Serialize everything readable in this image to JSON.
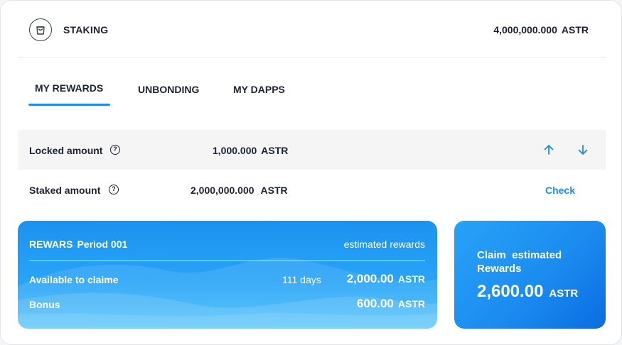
{
  "header": {
    "title": "STAKING",
    "icon": "bag-icon",
    "balance_value": "4,000,000.000",
    "balance_unit": "ASTR"
  },
  "tabs": [
    {
      "label": "MY REWARDS",
      "active": true
    },
    {
      "label": "UNBONDING",
      "active": false
    },
    {
      "label": "MY DAPPS",
      "active": false
    }
  ],
  "locked": {
    "label": "Locked amount",
    "help": "?",
    "value": "1,000.000",
    "unit": "ASTR",
    "actions": [
      "arrow-up-icon",
      "arrow-down-icon"
    ]
  },
  "staked": {
    "label": "Staked amount",
    "help": "?",
    "value": "2,000,000.000",
    "unit": "ASTR",
    "action_label": "Check"
  },
  "rewards": {
    "title": "REWARS",
    "period": "Period 001",
    "right_caption": "estimated rewards",
    "available_label": "Available to claime",
    "days": "111 days",
    "available_value": "2,000.00",
    "available_unit": "ASTR",
    "bonus_label": "Bonus",
    "bonus_value": "600.00",
    "bonus_unit": "ASTR"
  },
  "claim": {
    "title": "Claim  estimated Rewards",
    "value": "2,600.00",
    "unit": "ASTR"
  },
  "colors": {
    "accent": "#1b8fe8",
    "text": "#1c2230",
    "row_gray": "#f5f5f6"
  }
}
